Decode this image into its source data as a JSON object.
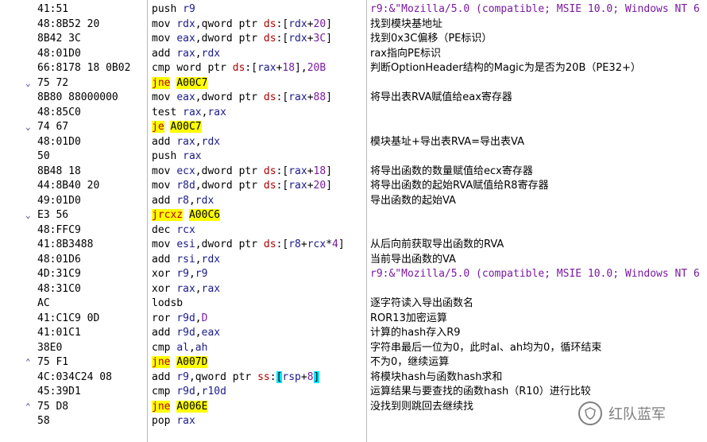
{
  "rows": [
    {
      "arrow": "",
      "bytes": "41:51",
      "asm": [
        [
          "mnem",
          "push"
        ],
        [
          "sp",
          " "
        ],
        [
          "op",
          "r9"
        ]
      ],
      "comment": [
        [
          "str",
          "r9:&\"Mozilla/5.0 (compatible; MSIE 10.0; Windows NT 6"
        ]
      ]
    },
    {
      "arrow": "",
      "bytes": "48:8B52 20",
      "asm": [
        [
          "mnem",
          "mov"
        ],
        [
          "sp",
          " "
        ],
        [
          "op",
          "rdx"
        ],
        [
          "t",
          ","
        ],
        [
          "t",
          "qword ptr "
        ],
        [
          "seg",
          "ds"
        ],
        [
          "t",
          ":["
        ],
        [
          "op",
          "rdx"
        ],
        [
          "t",
          "+"
        ],
        [
          "num",
          "20"
        ],
        [
          "t",
          "]"
        ]
      ],
      "comment": [
        [
          "zh",
          "找到模块基地址"
        ]
      ]
    },
    {
      "arrow": "",
      "bytes": "8B42 3C",
      "asm": [
        [
          "mnem",
          "mov"
        ],
        [
          "sp",
          " "
        ],
        [
          "op",
          "eax"
        ],
        [
          "t",
          ","
        ],
        [
          "t",
          "dword ptr "
        ],
        [
          "seg",
          "ds"
        ],
        [
          "t",
          ":["
        ],
        [
          "op",
          "rdx"
        ],
        [
          "t",
          "+"
        ],
        [
          "num",
          "3C"
        ],
        [
          "t",
          "]"
        ]
      ],
      "comment": [
        [
          "zh",
          "找到0x3C偏移（PE标识）"
        ]
      ]
    },
    {
      "arrow": "",
      "bytes": "48:01D0",
      "asm": [
        [
          "mnem",
          "add"
        ],
        [
          "sp",
          " "
        ],
        [
          "op",
          "rax"
        ],
        [
          "t",
          ","
        ],
        [
          "op",
          "rdx"
        ]
      ],
      "comment": [
        [
          "zh",
          "rax指向PE标识"
        ]
      ]
    },
    {
      "arrow": "",
      "bytes": "66:8178 18 0B02",
      "asm": [
        [
          "mnem",
          "cmp"
        ],
        [
          "sp",
          " "
        ],
        [
          "t",
          "word ptr "
        ],
        [
          "seg",
          "ds"
        ],
        [
          "t",
          ":["
        ],
        [
          "op",
          "rax"
        ],
        [
          "t",
          "+"
        ],
        [
          "num",
          "18"
        ],
        [
          "t",
          "],"
        ],
        [
          "num",
          "20B"
        ]
      ],
      "comment": [
        [
          "zh",
          "判断OptionHeader结构的Magic为是否为20B（PE32+）"
        ]
      ]
    },
    {
      "arrow": "v",
      "bytes": "75 72",
      "asm": [
        [
          "jmp",
          "jne"
        ],
        [
          "sp",
          " "
        ],
        [
          "addr",
          "A00C7"
        ]
      ],
      "comment": []
    },
    {
      "arrow": "",
      "bytes": "8B80 88000000",
      "asm": [
        [
          "mnem",
          "mov"
        ],
        [
          "sp",
          " "
        ],
        [
          "op",
          "eax"
        ],
        [
          "t",
          ","
        ],
        [
          "t",
          "dword ptr "
        ],
        [
          "seg",
          "ds"
        ],
        [
          "t",
          ":["
        ],
        [
          "op",
          "rax"
        ],
        [
          "t",
          "+"
        ],
        [
          "num",
          "88"
        ],
        [
          "t",
          "]"
        ]
      ],
      "comment": [
        [
          "zh",
          "将导出表RVA赋值给eax寄存器"
        ]
      ]
    },
    {
      "arrow": "",
      "bytes": "48:85C0",
      "asm": [
        [
          "mnem",
          "test"
        ],
        [
          "sp",
          " "
        ],
        [
          "op",
          "rax"
        ],
        [
          "t",
          ","
        ],
        [
          "op",
          "rax"
        ]
      ],
      "comment": []
    },
    {
      "arrow": "v",
      "bytes": "74 67",
      "asm": [
        [
          "jmp",
          "je"
        ],
        [
          "sp",
          " "
        ],
        [
          "addr",
          "A00C7"
        ]
      ],
      "comment": []
    },
    {
      "arrow": "",
      "bytes": "48:01D0",
      "asm": [
        [
          "mnem",
          "add"
        ],
        [
          "sp",
          " "
        ],
        [
          "op",
          "rax"
        ],
        [
          "t",
          ","
        ],
        [
          "op",
          "rdx"
        ]
      ],
      "comment": [
        [
          "zh",
          "模块基址+导出表RVA=导出表VA"
        ]
      ]
    },
    {
      "arrow": "",
      "bytes": "50",
      "asm": [
        [
          "mnem",
          "push"
        ],
        [
          "sp",
          " "
        ],
        [
          "op",
          "rax"
        ]
      ],
      "comment": []
    },
    {
      "arrow": "",
      "bytes": "8B48 18",
      "asm": [
        [
          "mnem",
          "mov"
        ],
        [
          "sp",
          " "
        ],
        [
          "op",
          "ecx"
        ],
        [
          "t",
          ","
        ],
        [
          "t",
          "dword ptr "
        ],
        [
          "seg",
          "ds"
        ],
        [
          "t",
          ":["
        ],
        [
          "op",
          "rax"
        ],
        [
          "t",
          "+"
        ],
        [
          "num",
          "18"
        ],
        [
          "t",
          "]"
        ]
      ],
      "comment": [
        [
          "zh",
          "将导出函数的数量赋值给ecx寄存器"
        ]
      ]
    },
    {
      "arrow": "",
      "bytes": "44:8B40 20",
      "asm": [
        [
          "mnem",
          "mov"
        ],
        [
          "sp",
          " "
        ],
        [
          "op",
          "r8d"
        ],
        [
          "t",
          ","
        ],
        [
          "t",
          "dword ptr "
        ],
        [
          "seg",
          "ds"
        ],
        [
          "t",
          ":["
        ],
        [
          "op",
          "rax"
        ],
        [
          "t",
          "+"
        ],
        [
          "num",
          "20"
        ],
        [
          "t",
          "]"
        ]
      ],
      "comment": [
        [
          "zh",
          "将导出函数的起始RVA赋值给R8寄存器"
        ]
      ]
    },
    {
      "arrow": "",
      "bytes": "49:01D0",
      "asm": [
        [
          "mnem",
          "add"
        ],
        [
          "sp",
          " "
        ],
        [
          "op",
          "r8"
        ],
        [
          "t",
          ","
        ],
        [
          "op",
          "rdx"
        ]
      ],
      "comment": [
        [
          "zh",
          "导出函数的起始VA"
        ]
      ]
    },
    {
      "arrow": "v",
      "bytes": "E3 56",
      "asm": [
        [
          "jmp",
          "jrcxz"
        ],
        [
          "sp",
          " "
        ],
        [
          "addr",
          "A00C6"
        ]
      ],
      "comment": []
    },
    {
      "arrow": "",
      "bytes": "48:FFC9",
      "asm": [
        [
          "mnem",
          "dec"
        ],
        [
          "sp",
          " "
        ],
        [
          "op",
          "rcx"
        ]
      ],
      "comment": []
    },
    {
      "arrow": "",
      "bytes": "41:8B3488",
      "asm": [
        [
          "mnem",
          "mov"
        ],
        [
          "sp",
          " "
        ],
        [
          "op",
          "esi"
        ],
        [
          "t",
          ","
        ],
        [
          "t",
          "dword ptr "
        ],
        [
          "seg",
          "ds"
        ],
        [
          "t",
          ":["
        ],
        [
          "op",
          "r8"
        ],
        [
          "t",
          "+"
        ],
        [
          "op",
          "rcx"
        ],
        [
          "t",
          "*"
        ],
        [
          "num",
          "4"
        ],
        [
          "t",
          "]"
        ]
      ],
      "comment": [
        [
          "zh",
          "从后向前获取导出函数的RVA"
        ]
      ]
    },
    {
      "arrow": "",
      "bytes": "48:01D6",
      "asm": [
        [
          "mnem",
          "add"
        ],
        [
          "sp",
          " "
        ],
        [
          "op",
          "rsi"
        ],
        [
          "t",
          ","
        ],
        [
          "op",
          "rdx"
        ]
      ],
      "comment": [
        [
          "zh",
          "当前导出函数的VA"
        ]
      ]
    },
    {
      "arrow": "",
      "bytes": "4D:31C9",
      "asm": [
        [
          "mnem",
          "xor"
        ],
        [
          "sp",
          " "
        ],
        [
          "op",
          "r9"
        ],
        [
          "t",
          ","
        ],
        [
          "op",
          "r9"
        ]
      ],
      "comment": [
        [
          "str",
          "r9:&\"Mozilla/5.0 (compatible; MSIE 10.0; Windows NT 6"
        ]
      ]
    },
    {
      "arrow": "",
      "bytes": "48:31C0",
      "asm": [
        [
          "mnem",
          "xor"
        ],
        [
          "sp",
          " "
        ],
        [
          "op",
          "rax"
        ],
        [
          "t",
          ","
        ],
        [
          "op",
          "rax"
        ]
      ],
      "comment": []
    },
    {
      "arrow": "",
      "bytes": "AC",
      "asm": [
        [
          "mnem",
          "lodsb"
        ]
      ],
      "comment": [
        [
          "zh",
          "逐字符读入导出函数名"
        ]
      ]
    },
    {
      "arrow": "",
      "bytes": "41:C1C9 0D",
      "asm": [
        [
          "mnem",
          "ror"
        ],
        [
          "sp",
          " "
        ],
        [
          "op",
          "r9d"
        ],
        [
          "t",
          ","
        ],
        [
          "num",
          "D"
        ]
      ],
      "comment": [
        [
          "zh",
          "ROR13加密运算"
        ]
      ]
    },
    {
      "arrow": "",
      "bytes": "41:01C1",
      "asm": [
        [
          "mnem",
          "add"
        ],
        [
          "sp",
          " "
        ],
        [
          "op",
          "r9d"
        ],
        [
          "t",
          ","
        ],
        [
          "op",
          "eax"
        ]
      ],
      "comment": [
        [
          "zh",
          "计算的hash存入R9"
        ]
      ]
    },
    {
      "arrow": "",
      "bytes": "38E0",
      "asm": [
        [
          "mnem",
          "cmp"
        ],
        [
          "sp",
          " "
        ],
        [
          "op",
          "al"
        ],
        [
          "t",
          ","
        ],
        [
          "op",
          "ah"
        ]
      ],
      "comment": [
        [
          "zh",
          "字符串最后一位为0，此时al、ah均为0，循环结束"
        ]
      ]
    },
    {
      "arrow": "^",
      "bytes": "75 F1",
      "asm": [
        [
          "jmp",
          "jne"
        ],
        [
          "sp",
          " "
        ],
        [
          "addr",
          "A007D"
        ]
      ],
      "comment": [
        [
          "zh",
          "不为0，继续运算"
        ]
      ]
    },
    {
      "arrow": "",
      "bytes": "4C:034C24 08",
      "asm": [
        [
          "mnem",
          "add"
        ],
        [
          "sp",
          " "
        ],
        [
          "op",
          "r9"
        ],
        [
          "t",
          ","
        ],
        [
          "t",
          "qword ptr "
        ],
        [
          "seg",
          "ss"
        ],
        [
          "t",
          ":"
        ],
        [
          "hl",
          "["
        ],
        [
          "op",
          "rsp"
        ],
        [
          "t",
          "+"
        ],
        [
          "num",
          "8"
        ],
        [
          "hl",
          "]"
        ]
      ],
      "comment": [
        [
          "zh",
          "将模块hash与函数hash求和"
        ]
      ]
    },
    {
      "arrow": "",
      "bytes": "45:39D1",
      "asm": [
        [
          "mnem",
          "cmp"
        ],
        [
          "sp",
          " "
        ],
        [
          "op",
          "r9d"
        ],
        [
          "t",
          ","
        ],
        [
          "op",
          "r10d"
        ]
      ],
      "comment": [
        [
          "zh",
          "运算结果与要查找的函数hash（R10）进行比较"
        ]
      ]
    },
    {
      "arrow": "^",
      "bytes": "75 D8",
      "asm": [
        [
          "jmp",
          "jne"
        ],
        [
          "sp",
          " "
        ],
        [
          "addr",
          "A006E"
        ]
      ],
      "comment": [
        [
          "zh",
          "没找到则跳回去继续找"
        ]
      ]
    },
    {
      "arrow": "",
      "bytes": "58",
      "asm": [
        [
          "mnem",
          "pop"
        ],
        [
          "sp",
          " "
        ],
        [
          "op",
          "rax"
        ]
      ],
      "comment": []
    }
  ],
  "watermark": {
    "text": "红队蓝军"
  },
  "colors": {
    "jump_bg": "#ffff00",
    "jump_fg": "#b00000",
    "operand": "#1a1a8c",
    "segment": "#b00000",
    "number": "#7a1aa0",
    "bracket_highlight": "#00e5ff",
    "divider": "#b8b8b8"
  },
  "icons": {
    "arrow_down": "chevron-down-icon",
    "arrow_up": "chevron-up-icon",
    "watermark": "shield-icon"
  }
}
